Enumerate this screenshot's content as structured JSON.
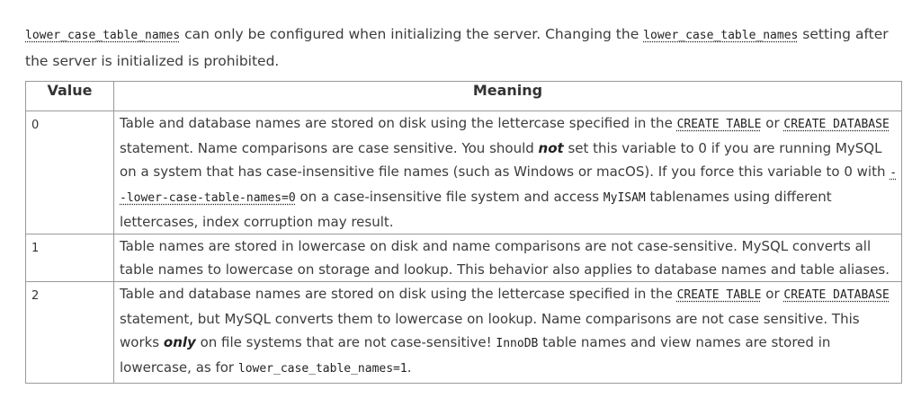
{
  "intro": {
    "code1": "lower_case_table_names",
    "text1": " can only be configured when initializing the server. Changing the ",
    "code2": "lower_case_table_names",
    "text2": " setting after the server is initialized is prohibited."
  },
  "table": {
    "headers": {
      "value": "Value",
      "meaning": "Meaning"
    },
    "rows": [
      {
        "value": "0",
        "t1": "Table and database names are stored on disk using the lettercase specified in the ",
        "c1": "CREATE TABLE",
        "t2": " or ",
        "c2": "CREATE DATABASE",
        "t3": " statement. Name comparisons are case sensitive. You should ",
        "em": "not",
        "t4": " set this variable to 0 if you are running MySQL on a system that has case-insensitive file names (such as Windows or macOS). If you force this variable to 0 with ",
        "c3": "--lower-case-table-names=0",
        "t5": " on a case-insensitive file system and access ",
        "c4": "MyISAM",
        "t6": " tablenames using different lettercases, index corruption may result."
      },
      {
        "value": "1",
        "text": "Table names are stored in lowercase on disk and name comparisons are not case-sensitive. MySQL converts all table names to lowercase on storage and lookup. This behavior also applies to database names and table aliases."
      },
      {
        "value": "2",
        "t1": "Table and database names are stored on disk using the lettercase specified in the ",
        "c1": "CREATE TABLE",
        "t2": " or ",
        "c2": "CREATE DATABASE",
        "t3": " statement, but MySQL converts them to lowercase on lookup. Name comparisons are not case sensitive. This works ",
        "em": "only",
        "t4": " on file systems that are not case-sensitive! ",
        "c3": "InnoDB",
        "t5": " table names and view names are stored in lowercase, as for ",
        "c4": "lower_case_table_names=1",
        "t6": "."
      }
    ]
  }
}
